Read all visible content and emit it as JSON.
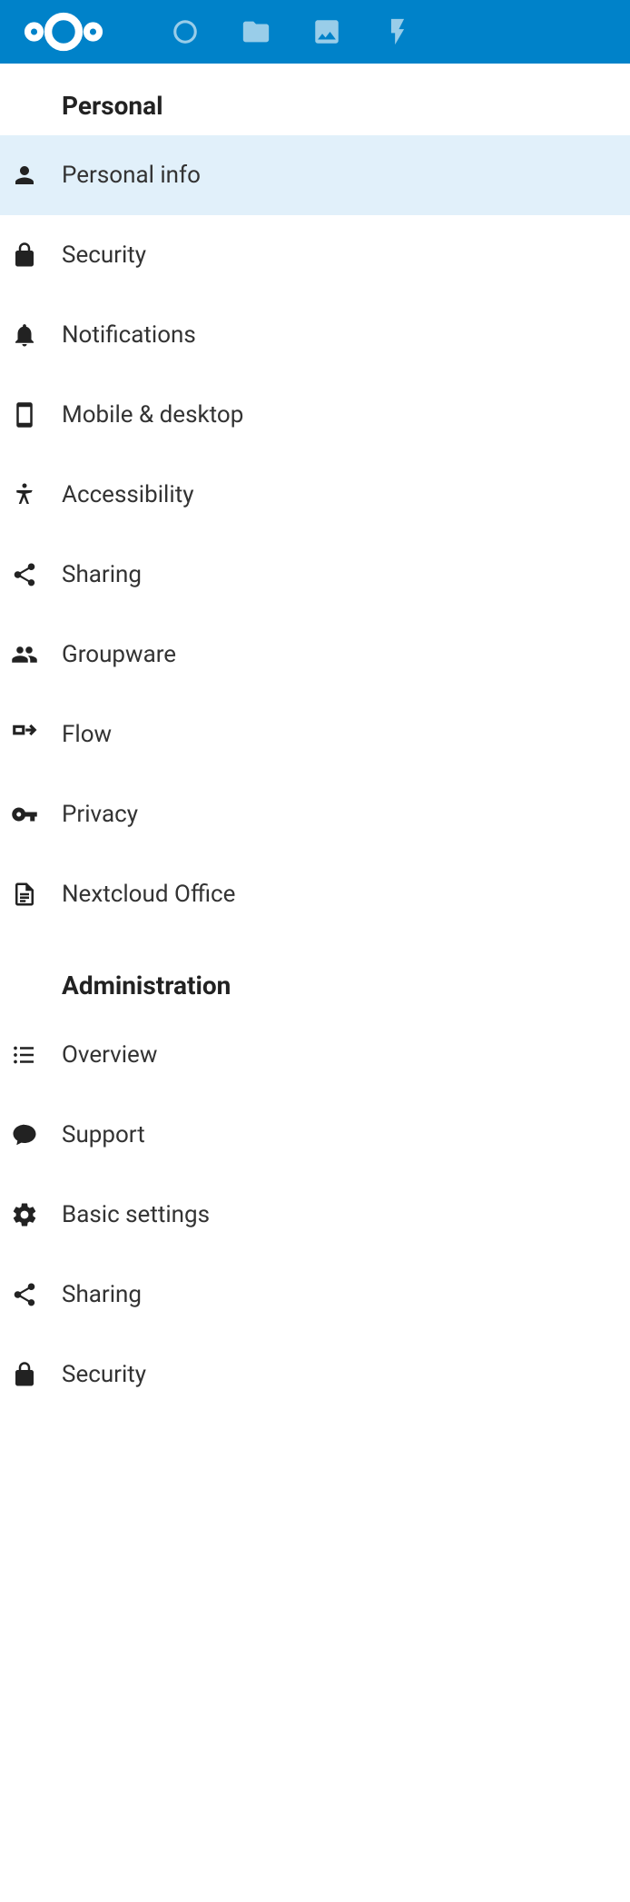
{
  "sections": {
    "personal": {
      "title": "Personal",
      "items": [
        {
          "label": "Personal info",
          "icon": "user",
          "active": true
        },
        {
          "label": "Security",
          "icon": "lock",
          "active": false
        },
        {
          "label": "Notifications",
          "icon": "bell",
          "active": false
        },
        {
          "label": "Mobile & desktop",
          "icon": "phone",
          "active": false
        },
        {
          "label": "Accessibility",
          "icon": "accessibility",
          "active": false
        },
        {
          "label": "Sharing",
          "icon": "share",
          "active": false
        },
        {
          "label": "Groupware",
          "icon": "users",
          "active": false
        },
        {
          "label": "Flow",
          "icon": "flow",
          "active": false
        },
        {
          "label": "Privacy",
          "icon": "key",
          "active": false
        },
        {
          "label": "Nextcloud Office",
          "icon": "document",
          "active": false
        }
      ]
    },
    "administration": {
      "title": "Administration",
      "items": [
        {
          "label": "Overview",
          "icon": "list",
          "active": false
        },
        {
          "label": "Support",
          "icon": "chat",
          "active": false
        },
        {
          "label": "Basic settings",
          "icon": "gear",
          "active": false
        },
        {
          "label": "Sharing",
          "icon": "share",
          "active": false
        },
        {
          "label": "Security",
          "icon": "lock",
          "active": false
        }
      ]
    }
  },
  "topbar": {
    "icons": [
      "dashboard",
      "files",
      "photos",
      "activity"
    ]
  }
}
